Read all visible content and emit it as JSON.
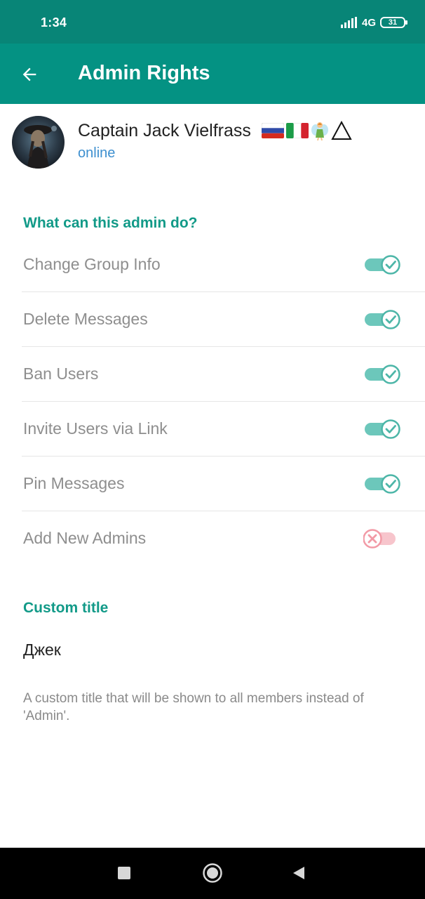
{
  "status_bar": {
    "time": "1:34",
    "network": "4G",
    "battery": "31"
  },
  "app_bar": {
    "title": "Admin Rights",
    "back_icon": "arrow-left-icon"
  },
  "profile": {
    "name": "Captain Jack Vielfrass",
    "status": "online",
    "badges": [
      "russia-flag-icon",
      "italy-flag-icon",
      "fairy-icon",
      "triangle-icon"
    ]
  },
  "rights_section": {
    "header": "What can this admin do?",
    "items": [
      {
        "label": "Change Group Info",
        "enabled": true
      },
      {
        "label": "Delete Messages",
        "enabled": true
      },
      {
        "label": "Ban Users",
        "enabled": true
      },
      {
        "label": "Invite Users via Link",
        "enabled": true
      },
      {
        "label": "Pin Messages",
        "enabled": true
      },
      {
        "label": "Add New Admins",
        "enabled": false
      }
    ]
  },
  "custom_title": {
    "header": "Custom title",
    "value": "Джек",
    "hint": "A custom title that will be shown to all members instead of 'Admin'."
  },
  "colors": {
    "status_bar": "#088577",
    "app_bar": "#049283",
    "accent": "#129a88",
    "toggle_on_track": "#6cc7bb",
    "toggle_on_thumb": "#4db6a8",
    "toggle_off_track": "#f7c5cc",
    "toggle_off_thumb": "#f29aa6",
    "status_online": "#3d8fcf"
  },
  "nav_bar": {
    "items": [
      "square-recents-icon",
      "circle-home-icon",
      "triangle-back-icon"
    ]
  }
}
